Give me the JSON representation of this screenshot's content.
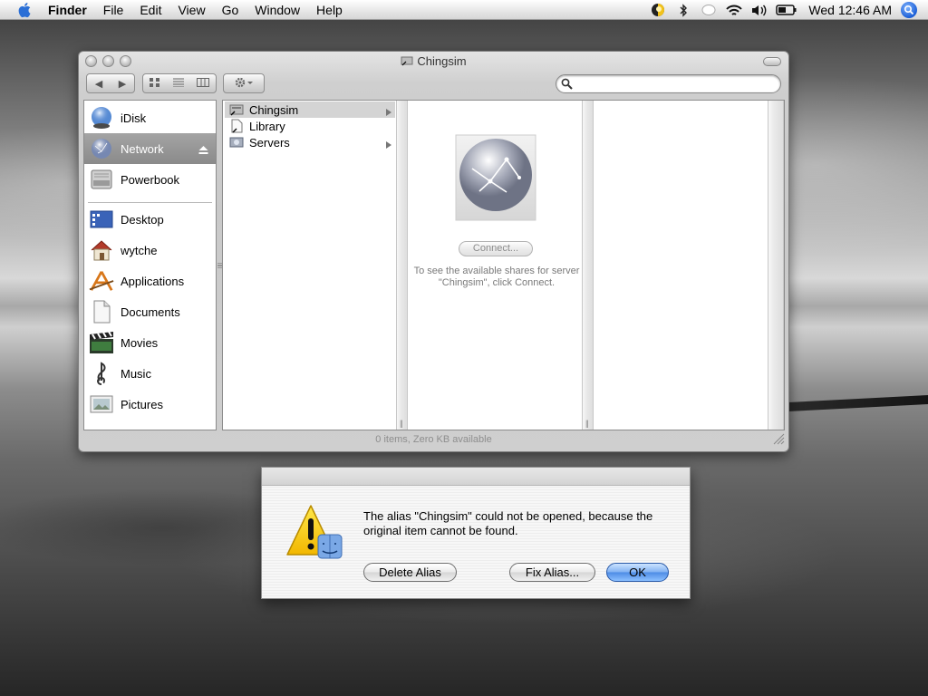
{
  "menubar": {
    "app_name": "Finder",
    "items": [
      "File",
      "Edit",
      "View",
      "Go",
      "Window",
      "Help"
    ],
    "clock": "Wed 12:46 AM",
    "status_icons": [
      "script-icon",
      "bluetooth-icon",
      "sync-icon",
      "wifi-icon",
      "volume-icon",
      "battery-icon"
    ]
  },
  "finder": {
    "title": "Chingsim",
    "search": {
      "value": "",
      "placeholder": ""
    },
    "sidebar": {
      "devices": [
        {
          "label": "iDisk",
          "icon": "idisk-icon"
        },
        {
          "label": "Network",
          "icon": "network-globe-icon",
          "selected": true
        },
        {
          "label": "Powerbook",
          "icon": "hard-drive-icon"
        }
      ],
      "places": [
        {
          "label": "Desktop",
          "icon": "desktop-folder-icon"
        },
        {
          "label": "wytche",
          "icon": "home-icon"
        },
        {
          "label": "Applications",
          "icon": "applications-icon"
        },
        {
          "label": "Documents",
          "icon": "documents-icon"
        },
        {
          "label": "Movies",
          "icon": "movies-icon"
        },
        {
          "label": "Music",
          "icon": "music-icon"
        },
        {
          "label": "Pictures",
          "icon": "pictures-icon"
        }
      ]
    },
    "column1": [
      {
        "label": "Chingsim",
        "selected": true,
        "has_children": true
      },
      {
        "label": "Library",
        "selected": false,
        "has_children": false
      },
      {
        "label": "Servers",
        "selected": false,
        "has_children": true
      }
    ],
    "connect": {
      "button_label": "Connect...",
      "help_text": "To see the available shares for server \"Chingsim\", click Connect."
    },
    "status": "0 items, Zero KB available"
  },
  "alert": {
    "message": "The alias \"Chingsim\" could not be opened, because the original item cannot be found.",
    "buttons": {
      "delete": "Delete Alias",
      "fix": "Fix Alias...",
      "ok": "OK"
    },
    "accent": "#4d8be5"
  }
}
